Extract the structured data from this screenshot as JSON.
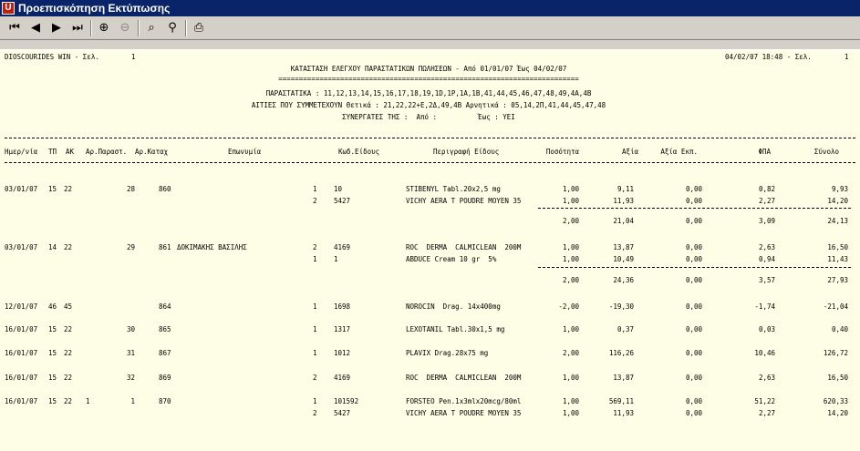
{
  "window": {
    "title": "Προεπισκόπηση Εκτύπωσης"
  },
  "toolbar": {
    "icons": [
      "first-page-icon",
      "prev-page-icon",
      "next-page-icon",
      "last-page-icon",
      "zoom-in-icon",
      "zoom-out-icon",
      "binoculars-icon",
      "find-next-icon",
      "printer-icon"
    ]
  },
  "report": {
    "app": "DIOSCOURIDES WIN - Σελ.",
    "page": "1",
    "datetime": "04/02/07 18:48 - Σελ.",
    "page_right": "1",
    "title": "ΚΑΤΑΣΤΑΣΗ ΕΛΕΓΧΟΥ ΠΑΡΑΣΤΑΤΙΚΩΝ ΠΩΛΗΣΕΩΝ - Από 01/01/07 Έως 04/02/07",
    "rule_eq": "=========================================================================",
    "line_parastatika": "ΠΑΡΑΣΤΑΤΙΚΑ : 11,12,13,14,15,16,17,18,19,1D,1P,1A,1B,41,44,45,46,47,48,49,4A,4B",
    "line_aities": "ΑΙΤΙΕΣ ΠΟΥ ΣΥΜΜΕΤΕΧΟΥΝ Θετικά : 21,22,22+E,2Δ,49,4B Αρνητικά : 05,14,2Π,41,44,45,47,48",
    "line_synergates": "ΣΥΝΕΡΓΑΤΕΣ ΤΗΣ :  Από :          Έως : ΥΕΙ",
    "headers": {
      "date": "Ημερ/νία",
      "tp": "ΤΠ",
      "ak": "ΑΚ",
      "ar_par": "Αρ.Παραστ.",
      "ar_kat": "Αρ.Καταχ",
      "name": "Επωνυμία",
      "code": "Κωδ.Είδους",
      "desc": "Περιγραφή Είδους",
      "qty": "Ποσότητα",
      "value": "Αξία",
      "value_ekp": "Αξία Εκπ.",
      "fpa": "ΦΠΑ",
      "total": "Σύνολο"
    },
    "rows": [
      {
        "date": "03/01/07",
        "tp": "15",
        "ak": "22",
        "ar_par": "28",
        "ar_kat": "860",
        "name": "",
        "seq": "1",
        "code": "10",
        "desc": "STIBENYL Tabl.20x2,5 mg",
        "qty": "1,00",
        "value": "9,11",
        "ekp": "0,00",
        "fpa": "0,82",
        "total": "9,93"
      },
      {
        "seq": "2",
        "code": "5427",
        "desc": "VICHY AERA T POUDRE MOYEN 35",
        "qty": "1,00",
        "value": "11,93",
        "ekp": "0,00",
        "fpa": "2,27",
        "total": "14,20"
      },
      {
        "subtotal": true,
        "qty": "2,00",
        "value": "21,04",
        "ekp": "0,00",
        "fpa": "3,09",
        "total": "24,13"
      },
      {
        "date": "03/01/07",
        "tp": "14",
        "ak": "22",
        "ar_par": "29",
        "ar_kat": "861",
        "name": "ΔΟΚΙΜΑΚΗΣ ΒΑΣΙΛΗΣ",
        "seq": "2",
        "code": "4169",
        "desc": "ROC  DERMA  CALMICLEAN  200M",
        "qty": "1,00",
        "value": "13,87",
        "ekp": "0,00",
        "fpa": "2,63",
        "total": "16,50"
      },
      {
        "seq": "1",
        "code": "1",
        "desc": "ABDUCE Cream 10 gr  5%",
        "qty": "1,00",
        "value": "10,49",
        "ekp": "0,00",
        "fpa": "0,94",
        "total": "11,43"
      },
      {
        "subtotal": true,
        "qty": "2,00",
        "value": "24,36",
        "ekp": "0,00",
        "fpa": "3,57",
        "total": "27,93"
      },
      {
        "date": "12/01/07",
        "tp": "46",
        "ak": "45",
        "ar_par": "",
        "ar_kat": "864",
        "name": "",
        "seq": "1",
        "code": "1698",
        "desc": "NOROCIN  Drag. 14x400mg",
        "qty": "-2,00",
        "value": "-19,30",
        "ekp": "0,00",
        "fpa": "-1,74",
        "total": "-21,04"
      },
      {
        "date": "16/01/07",
        "tp": "15",
        "ak": "22",
        "ar_par": "30",
        "ar_kat": "865",
        "name": "",
        "seq": "1",
        "code": "1317",
        "desc": "LEXOTANIL Tabl.30x1,5 mg",
        "qty": "1,00",
        "value": "0,37",
        "ekp": "0,00",
        "fpa": "0,03",
        "total": "0,40"
      },
      {
        "date": "16/01/07",
        "tp": "15",
        "ak": "22",
        "ar_par": "31",
        "ar_kat": "867",
        "name": "",
        "seq": "1",
        "code": "1012",
        "desc": "PLAVIX Drag.28x75 mg",
        "qty": "2,00",
        "value": "116,26",
        "ekp": "0,00",
        "fpa": "10,46",
        "total": "126,72"
      },
      {
        "date": "16/01/07",
        "tp": "15",
        "ak": "22",
        "ar_par": "32",
        "ar_kat": "869",
        "name": "",
        "seq": "2",
        "code": "4169",
        "desc": "ROC  DERMA  CALMICLEAN  200M",
        "qty": "1,00",
        "value": "13,87",
        "ekp": "0,00",
        "fpa": "2,63",
        "total": "16,50"
      },
      {
        "date": "16/01/07",
        "tp": "15",
        "ak": "22",
        "extra": "1",
        "ar_par": "1",
        "ar_kat": "870",
        "name": "",
        "seq": "1",
        "code": "101592",
        "desc": "FORSTEO Pen.1x3mlx20mcg/80ml",
        "qty": "1,00",
        "value": "569,11",
        "ekp": "0,00",
        "fpa": "51,22",
        "total": "620,33"
      },
      {
        "seq": "2",
        "code": "5427",
        "desc": "VICHY AERA T POUDRE MOYEN 35",
        "qty": "1,00",
        "value": "11,93",
        "ekp": "0,00",
        "fpa": "2,27",
        "total": "14,20"
      }
    ]
  }
}
